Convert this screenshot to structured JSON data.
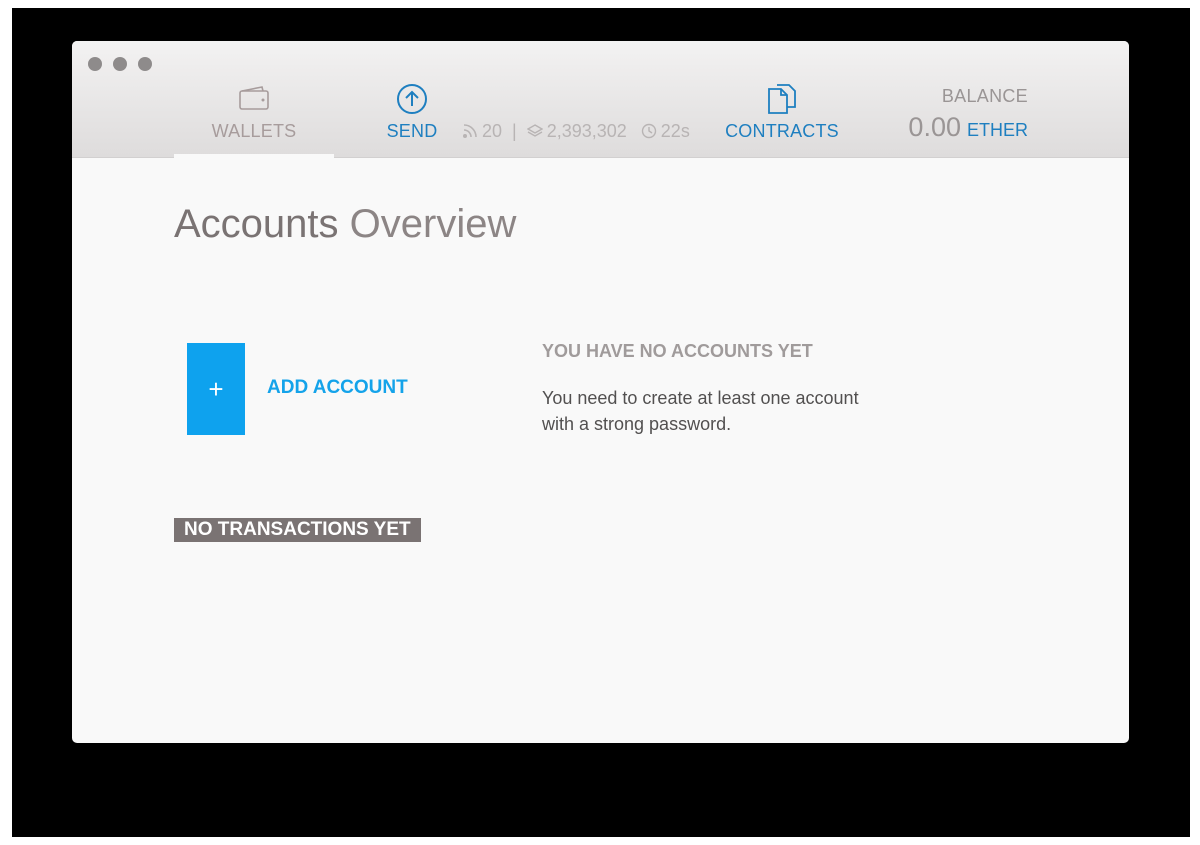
{
  "nav": {
    "wallets": {
      "label": "WALLETS",
      "icon": "wallet-icon"
    },
    "send": {
      "label": "SEND",
      "icon": "arrow-up-circle-icon"
    },
    "contracts": {
      "label": "CONTRACTS",
      "icon": "documents-icon"
    }
  },
  "status": {
    "peers": "20",
    "block": "2,393,302",
    "time": "22s"
  },
  "balance": {
    "label": "BALANCE",
    "amount": "0.00",
    "unit": "ETHER"
  },
  "page": {
    "title_strong": "Accounts",
    "title_light": "Overview"
  },
  "add_account": {
    "icon": "+",
    "label": "ADD ACCOUNT"
  },
  "empty_state": {
    "heading": "YOU HAVE NO ACCOUNTS YET",
    "description": "You need to create at least one account with a strong password."
  },
  "transactions": {
    "empty_label": "NO TRANSACTIONS YET"
  },
  "colors": {
    "accent": "#1e7fc0",
    "add_tile": "#0ea2ee",
    "badge": "#7a7373"
  }
}
